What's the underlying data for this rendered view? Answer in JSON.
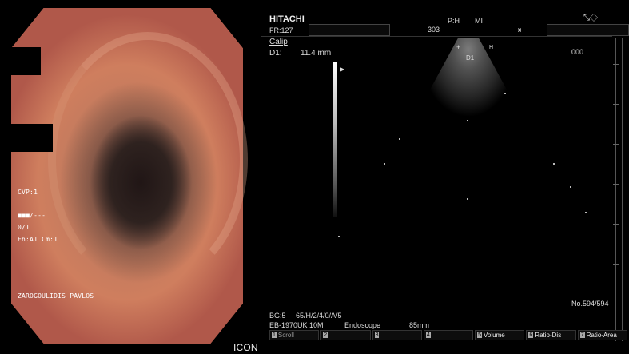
{
  "endoscopy": {
    "cvp": "CVP:1",
    "bar": "■■■/---",
    "ratio": "0/1",
    "eh": "Eh:A1 Cm:1",
    "patient_name": "ZAROGOULIDIS PAVLOS",
    "icon_label": "ICON"
  },
  "ultrasound": {
    "brand": "HITACHI",
    "frame_rate": "FR:127",
    "center_value": "303",
    "probe_mode": "P:H",
    "mi_label": "MI",
    "calip_label": "Calip",
    "d1_label": "D1:",
    "d1_value": "11.4 mm",
    "corner_value": "000",
    "image_number": "No.594/594",
    "d1_marker": "D1",
    "h_marker": "H",
    "bg": "BG:5",
    "params": "65/H/2/4/0/A/5",
    "scope_model": "EB-1970UK 10M",
    "scope_label": "Endoscope",
    "depth": "85mm",
    "softkeys": [
      {
        "num": "1",
        "label": "Scroll"
      },
      {
        "num": "2",
        "label": ""
      },
      {
        "num": "3",
        "label": ""
      },
      {
        "num": "4",
        "label": ""
      },
      {
        "num": "5",
        "label": "Volume"
      },
      {
        "num": "6",
        "label": "Ratio-Dis"
      },
      {
        "num": "7",
        "label": "Ratio-Area"
      }
    ]
  },
  "icons": [
    "arrow-to-bar-icon",
    "probe-icon",
    "gray-scale-marker-icon"
  ]
}
